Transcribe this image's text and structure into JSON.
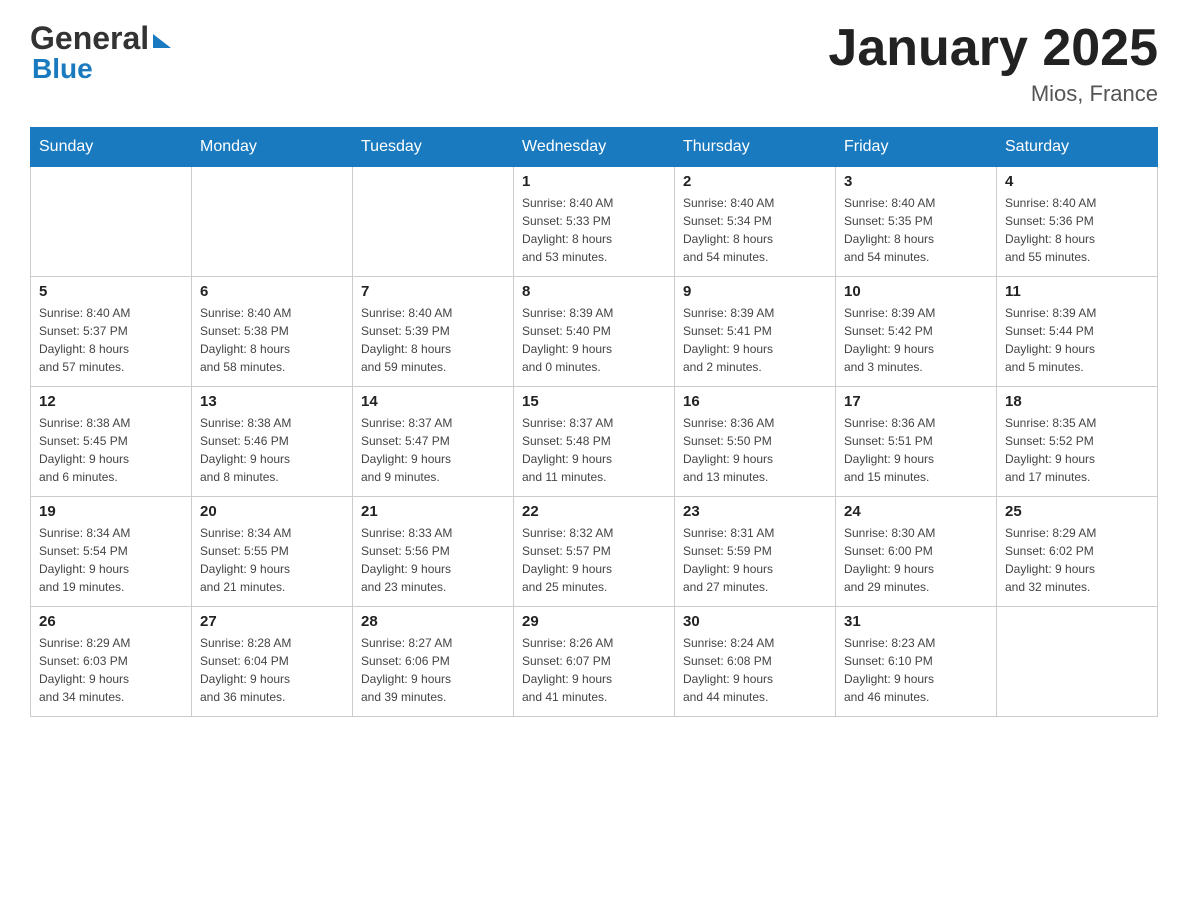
{
  "header": {
    "logo_line1": "General",
    "logo_line2": "Blue",
    "month_title": "January 2025",
    "location": "Mios, France"
  },
  "weekdays": [
    "Sunday",
    "Monday",
    "Tuesday",
    "Wednesday",
    "Thursday",
    "Friday",
    "Saturday"
  ],
  "weeks": [
    [
      {
        "day": "",
        "info": ""
      },
      {
        "day": "",
        "info": ""
      },
      {
        "day": "",
        "info": ""
      },
      {
        "day": "1",
        "info": "Sunrise: 8:40 AM\nSunset: 5:33 PM\nDaylight: 8 hours\nand 53 minutes."
      },
      {
        "day": "2",
        "info": "Sunrise: 8:40 AM\nSunset: 5:34 PM\nDaylight: 8 hours\nand 54 minutes."
      },
      {
        "day": "3",
        "info": "Sunrise: 8:40 AM\nSunset: 5:35 PM\nDaylight: 8 hours\nand 54 minutes."
      },
      {
        "day": "4",
        "info": "Sunrise: 8:40 AM\nSunset: 5:36 PM\nDaylight: 8 hours\nand 55 minutes."
      }
    ],
    [
      {
        "day": "5",
        "info": "Sunrise: 8:40 AM\nSunset: 5:37 PM\nDaylight: 8 hours\nand 57 minutes."
      },
      {
        "day": "6",
        "info": "Sunrise: 8:40 AM\nSunset: 5:38 PM\nDaylight: 8 hours\nand 58 minutes."
      },
      {
        "day": "7",
        "info": "Sunrise: 8:40 AM\nSunset: 5:39 PM\nDaylight: 8 hours\nand 59 minutes."
      },
      {
        "day": "8",
        "info": "Sunrise: 8:39 AM\nSunset: 5:40 PM\nDaylight: 9 hours\nand 0 minutes."
      },
      {
        "day": "9",
        "info": "Sunrise: 8:39 AM\nSunset: 5:41 PM\nDaylight: 9 hours\nand 2 minutes."
      },
      {
        "day": "10",
        "info": "Sunrise: 8:39 AM\nSunset: 5:42 PM\nDaylight: 9 hours\nand 3 minutes."
      },
      {
        "day": "11",
        "info": "Sunrise: 8:39 AM\nSunset: 5:44 PM\nDaylight: 9 hours\nand 5 minutes."
      }
    ],
    [
      {
        "day": "12",
        "info": "Sunrise: 8:38 AM\nSunset: 5:45 PM\nDaylight: 9 hours\nand 6 minutes."
      },
      {
        "day": "13",
        "info": "Sunrise: 8:38 AM\nSunset: 5:46 PM\nDaylight: 9 hours\nand 8 minutes."
      },
      {
        "day": "14",
        "info": "Sunrise: 8:37 AM\nSunset: 5:47 PM\nDaylight: 9 hours\nand 9 minutes."
      },
      {
        "day": "15",
        "info": "Sunrise: 8:37 AM\nSunset: 5:48 PM\nDaylight: 9 hours\nand 11 minutes."
      },
      {
        "day": "16",
        "info": "Sunrise: 8:36 AM\nSunset: 5:50 PM\nDaylight: 9 hours\nand 13 minutes."
      },
      {
        "day": "17",
        "info": "Sunrise: 8:36 AM\nSunset: 5:51 PM\nDaylight: 9 hours\nand 15 minutes."
      },
      {
        "day": "18",
        "info": "Sunrise: 8:35 AM\nSunset: 5:52 PM\nDaylight: 9 hours\nand 17 minutes."
      }
    ],
    [
      {
        "day": "19",
        "info": "Sunrise: 8:34 AM\nSunset: 5:54 PM\nDaylight: 9 hours\nand 19 minutes."
      },
      {
        "day": "20",
        "info": "Sunrise: 8:34 AM\nSunset: 5:55 PM\nDaylight: 9 hours\nand 21 minutes."
      },
      {
        "day": "21",
        "info": "Sunrise: 8:33 AM\nSunset: 5:56 PM\nDaylight: 9 hours\nand 23 minutes."
      },
      {
        "day": "22",
        "info": "Sunrise: 8:32 AM\nSunset: 5:57 PM\nDaylight: 9 hours\nand 25 minutes."
      },
      {
        "day": "23",
        "info": "Sunrise: 8:31 AM\nSunset: 5:59 PM\nDaylight: 9 hours\nand 27 minutes."
      },
      {
        "day": "24",
        "info": "Sunrise: 8:30 AM\nSunset: 6:00 PM\nDaylight: 9 hours\nand 29 minutes."
      },
      {
        "day": "25",
        "info": "Sunrise: 8:29 AM\nSunset: 6:02 PM\nDaylight: 9 hours\nand 32 minutes."
      }
    ],
    [
      {
        "day": "26",
        "info": "Sunrise: 8:29 AM\nSunset: 6:03 PM\nDaylight: 9 hours\nand 34 minutes."
      },
      {
        "day": "27",
        "info": "Sunrise: 8:28 AM\nSunset: 6:04 PM\nDaylight: 9 hours\nand 36 minutes."
      },
      {
        "day": "28",
        "info": "Sunrise: 8:27 AM\nSunset: 6:06 PM\nDaylight: 9 hours\nand 39 minutes."
      },
      {
        "day": "29",
        "info": "Sunrise: 8:26 AM\nSunset: 6:07 PM\nDaylight: 9 hours\nand 41 minutes."
      },
      {
        "day": "30",
        "info": "Sunrise: 8:24 AM\nSunset: 6:08 PM\nDaylight: 9 hours\nand 44 minutes."
      },
      {
        "day": "31",
        "info": "Sunrise: 8:23 AM\nSunset: 6:10 PM\nDaylight: 9 hours\nand 46 minutes."
      },
      {
        "day": "",
        "info": ""
      }
    ]
  ]
}
